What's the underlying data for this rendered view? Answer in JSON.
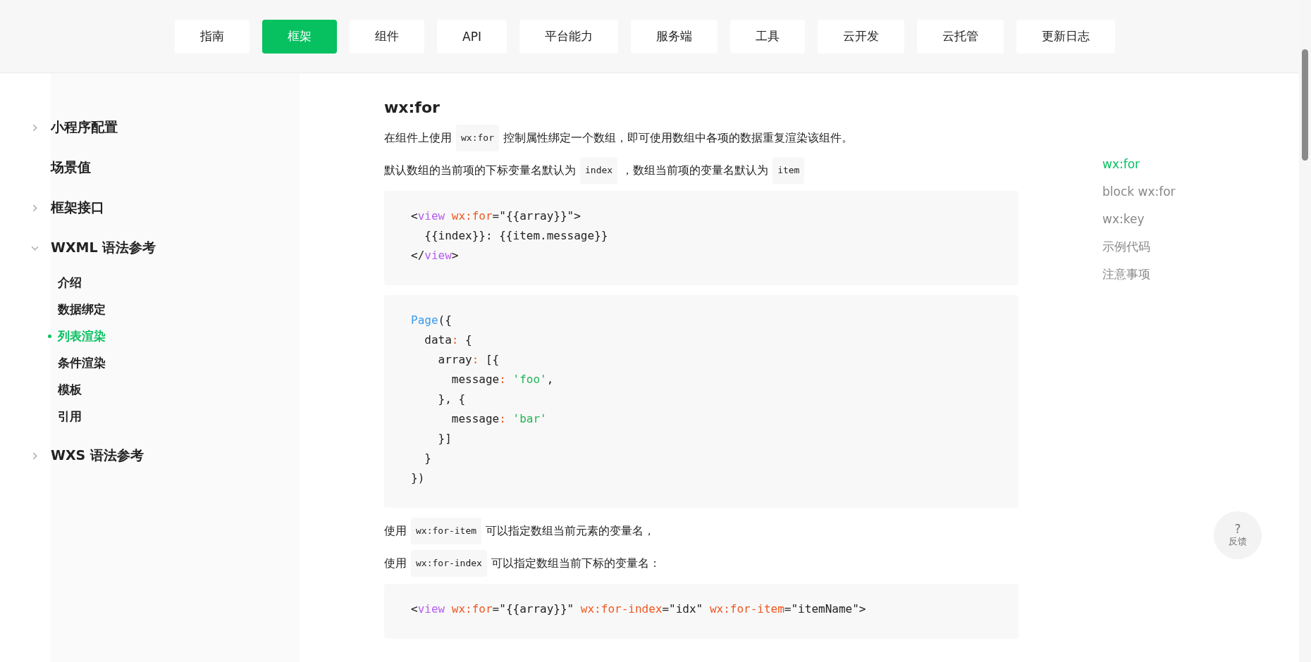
{
  "nav": [
    {
      "label": "指南",
      "selected": false
    },
    {
      "label": "框架",
      "selected": true
    },
    {
      "label": "组件",
      "selected": false
    },
    {
      "label": "API",
      "selected": false
    },
    {
      "label": "平台能力",
      "selected": false
    },
    {
      "label": "服务端",
      "selected": false
    },
    {
      "label": "工具",
      "selected": false
    },
    {
      "label": "云开发",
      "selected": false
    },
    {
      "label": "云托管",
      "selected": false
    },
    {
      "label": "更新日志",
      "selected": false
    }
  ],
  "sidebar": {
    "items": [
      {
        "label": "小程序配置",
        "expanded": false
      },
      {
        "label": "场景值"
      },
      {
        "label": "框架接口",
        "expanded": false
      },
      {
        "label": "WXML 语法参考",
        "expanded": true,
        "children": [
          {
            "label": "介绍",
            "selected": false
          },
          {
            "label": "数据绑定",
            "selected": false
          },
          {
            "label": "列表渲染",
            "selected": true
          },
          {
            "label": "条件渲染",
            "selected": false
          },
          {
            "label": "模板",
            "selected": false
          },
          {
            "label": "引用",
            "selected": false
          }
        ]
      },
      {
        "label": "WXS 语法参考",
        "expanded": false
      }
    ]
  },
  "content": {
    "title": "wx:for",
    "blocks": [
      {
        "kind": "paragraph",
        "segments": [
          {
            "kind": "text",
            "text": "在组件上使用"
          },
          {
            "kind": "code",
            "text": "wx:for"
          },
          {
            "kind": "text",
            "text": "控制属性绑定一个数组，即可使用数组中各项的数据重复渲染该组件。"
          }
        ]
      },
      {
        "kind": "paragraph",
        "segments": [
          {
            "kind": "text",
            "text": "默认数组的当前项的下标变量名默认为"
          },
          {
            "kind": "code",
            "text": "index"
          },
          {
            "kind": "text",
            "text": "，数组当前项的变量名默认为"
          },
          {
            "kind": "code",
            "text": "item"
          }
        ]
      },
      {
        "kind": "code",
        "lines": [
          [
            {
              "kind": "plain",
              "text": "<"
            },
            {
              "kind": "tag",
              "text": "view"
            },
            {
              "kind": "attr",
              "text": " wx:for"
            },
            {
              "kind": "plain",
              "text": "=\"{{array}}\">"
            }
          ],
          [
            {
              "kind": "plain",
              "text": "  {{index}}: {{item.message}}"
            }
          ],
          [
            {
              "kind": "plain",
              "text": "</"
            },
            {
              "kind": "tag",
              "text": "view"
            },
            {
              "kind": "plain",
              "text": ">"
            }
          ]
        ]
      },
      {
        "kind": "code",
        "lines": [
          [
            {
              "kind": "func",
              "text": "Page"
            },
            {
              "kind": "plain",
              "text": "({"
            }
          ],
          [
            {
              "kind": "plain",
              "text": "  data"
            },
            {
              "kind": "attr",
              "text": ":"
            },
            {
              "kind": "plain",
              "text": " {"
            }
          ],
          [
            {
              "kind": "plain",
              "text": "    array"
            },
            {
              "kind": "attr",
              "text": ":"
            },
            {
              "kind": "plain",
              "text": " [{"
            }
          ],
          [
            {
              "kind": "plain",
              "text": "      message"
            },
            {
              "kind": "attr",
              "text": ":"
            },
            {
              "kind": "string",
              "text": " 'foo'"
            },
            {
              "kind": "plain",
              "text": ","
            }
          ],
          [
            {
              "kind": "plain",
              "text": "    }, {"
            }
          ],
          [
            {
              "kind": "plain",
              "text": "      message"
            },
            {
              "kind": "attr",
              "text": ":"
            },
            {
              "kind": "string",
              "text": " 'bar'"
            }
          ],
          [
            {
              "kind": "plain",
              "text": "    }]"
            }
          ],
          [
            {
              "kind": "plain",
              "text": "  }"
            }
          ],
          [
            {
              "kind": "plain",
              "text": "})"
            }
          ]
        ]
      },
      {
        "kind": "paragraph",
        "segments": [
          {
            "kind": "text",
            "text": "使用"
          },
          {
            "kind": "code",
            "text": "wx:for-item"
          },
          {
            "kind": "text",
            "text": "可以指定数组当前元素的变量名，"
          }
        ]
      },
      {
        "kind": "paragraph",
        "segments": [
          {
            "kind": "text",
            "text": "使用"
          },
          {
            "kind": "code",
            "text": "wx:for-index"
          },
          {
            "kind": "text",
            "text": "可以指定数组当前下标的变量名："
          }
        ]
      },
      {
        "kind": "code",
        "lines": [
          [
            {
              "kind": "plain",
              "text": "<"
            },
            {
              "kind": "tag",
              "text": "view"
            },
            {
              "kind": "attr",
              "text": " wx:for"
            },
            {
              "kind": "plain",
              "text": "=\"{{array}}\" "
            },
            {
              "kind": "attr",
              "text": "wx:for-index"
            },
            {
              "kind": "plain",
              "text": "=\"idx\" "
            },
            {
              "kind": "attr",
              "text": "wx:for-item"
            },
            {
              "kind": "plain",
              "text": "=\"itemName\">"
            }
          ]
        ]
      }
    ]
  },
  "toc": [
    {
      "label": "wx:for",
      "selected": true
    },
    {
      "label": "block wx:for",
      "selected": false
    },
    {
      "label": "wx:key",
      "selected": false
    },
    {
      "label": "示例代码",
      "selected": false
    },
    {
      "label": "注意事项",
      "selected": false
    }
  ],
  "feedback": {
    "icon": "?",
    "label": "反馈"
  }
}
